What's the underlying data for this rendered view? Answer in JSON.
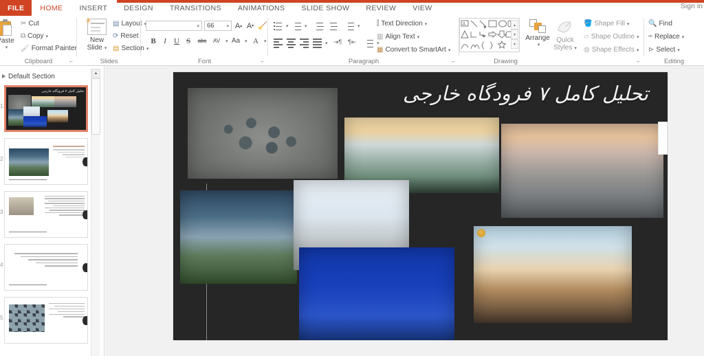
{
  "window": {
    "signin_label": "Sign in",
    "accent_color": "#d04423"
  },
  "tabs": [
    {
      "label": "FILE",
      "state": "file"
    },
    {
      "label": "HOME",
      "state": "active"
    },
    {
      "label": "INSERT",
      "state": "normal"
    },
    {
      "label": "DESIGN",
      "state": "normal"
    },
    {
      "label": "TRANSITIONS",
      "state": "normal"
    },
    {
      "label": "ANIMATIONS",
      "state": "normal"
    },
    {
      "label": "SLIDE SHOW",
      "state": "normal"
    },
    {
      "label": "REVIEW",
      "state": "normal"
    },
    {
      "label": "VIEW",
      "state": "normal"
    }
  ],
  "ribbon": {
    "clipboard": {
      "title": "Clipboard",
      "paste": "Paste",
      "cut": "Cut",
      "copy": "Copy",
      "format_painter": "Format Painter"
    },
    "slides": {
      "title": "Slides",
      "new_slide": "New\nSlide",
      "new_slide_line1": "New",
      "new_slide_line2": "Slide",
      "layout": "Layout",
      "reset": "Reset",
      "section": "Section"
    },
    "font": {
      "title": "Font",
      "font_name_value": "",
      "font_name_placeholder": "",
      "font_size_value": "66",
      "bold": "B",
      "italic": "I",
      "underline": "U",
      "shadow": "S",
      "strikethrough": "abc",
      "character_spacing": "AV",
      "change_case": "Aa",
      "font_color": "A"
    },
    "paragraph": {
      "title": "Paragraph",
      "text_direction": "Text Direction",
      "align_text": "Align Text",
      "convert_to_smartart": "Convert to SmartArt"
    },
    "drawing": {
      "title": "Drawing",
      "arrange": "Arrange",
      "quick_styles_line1": "Quick",
      "quick_styles_line2": "Styles",
      "shape_fill": "Shape Fill",
      "shape_outline": "Shape Outline",
      "shape_effects": "Shape Effects"
    },
    "editing": {
      "title": "Editing",
      "find": "Find",
      "replace": "Replace",
      "select": "Select"
    }
  },
  "slide_pane": {
    "section_name": "Default Section",
    "slides": [
      {
        "number": "1",
        "selected": true,
        "kind": "collage"
      },
      {
        "number": "2",
        "selected": false,
        "kind": "photo-text"
      },
      {
        "number": "3",
        "selected": false,
        "kind": "photo-text"
      },
      {
        "number": "4",
        "selected": false,
        "kind": "text-only"
      },
      {
        "number": "5",
        "selected": false,
        "kind": "photo-text"
      }
    ]
  },
  "slide": {
    "title": "تحلیل کامل ۷ فرودگاه خارجی",
    "background_color": "#262626",
    "images": [
      {
        "name": "aerial-terminal-roof",
        "style": "p-aerial"
      },
      {
        "name": "curved-terminal-sunrise",
        "style": "p-sunrise"
      },
      {
        "name": "coastal-airport-dusk",
        "style": "p-dusk"
      },
      {
        "name": "control-tower-garden",
        "style": "p-tower"
      },
      {
        "name": "white-canopy-terminal",
        "style": "p-terminal"
      },
      {
        "name": "blue-night-terminal",
        "style": "p-blue"
      },
      {
        "name": "tower-render-sunset",
        "style": "p-night"
      }
    ]
  }
}
